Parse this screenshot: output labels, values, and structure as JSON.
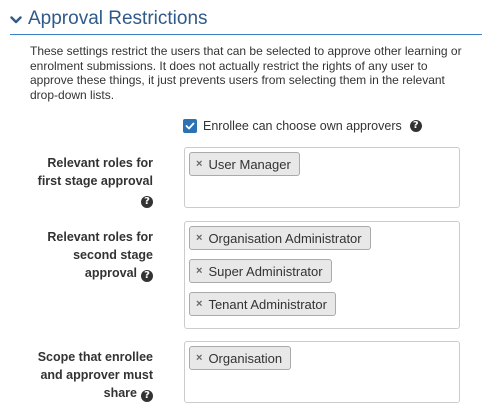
{
  "section": {
    "title": "Approval Restrictions",
    "description": "These settings restrict the users that can be selected to approve other learning or enrolment submissions. It does not actually restrict the rights of any user to approve these things, it just prevents users from selecting them in the relevant drop-down lists."
  },
  "own_approvers": {
    "label": "Enrollee can choose own approvers",
    "checked": true
  },
  "fields": {
    "first_stage": {
      "label_line1": "Relevant roles for",
      "label_line2": "first stage approval",
      "tags": [
        "User Manager"
      ]
    },
    "second_stage": {
      "label_line1": "Relevant roles for",
      "label_line2": "second stage",
      "label_line3": "approval",
      "tags": [
        "Organisation Administrator",
        "Super Administrator",
        "Tenant Administrator"
      ]
    },
    "scope": {
      "label_line1": "Scope that enrollee",
      "label_line2": "and approver must",
      "label_line3": "share",
      "tags": [
        "Organisation"
      ]
    }
  },
  "icons": {
    "remove": "×",
    "help": "?",
    "chevron": "chevron-down-icon",
    "checkbox": "check-icon"
  },
  "colors": {
    "accent": "#2a72b5",
    "title": "#2f5a8a",
    "tag_bg": "#e8e8e8"
  }
}
